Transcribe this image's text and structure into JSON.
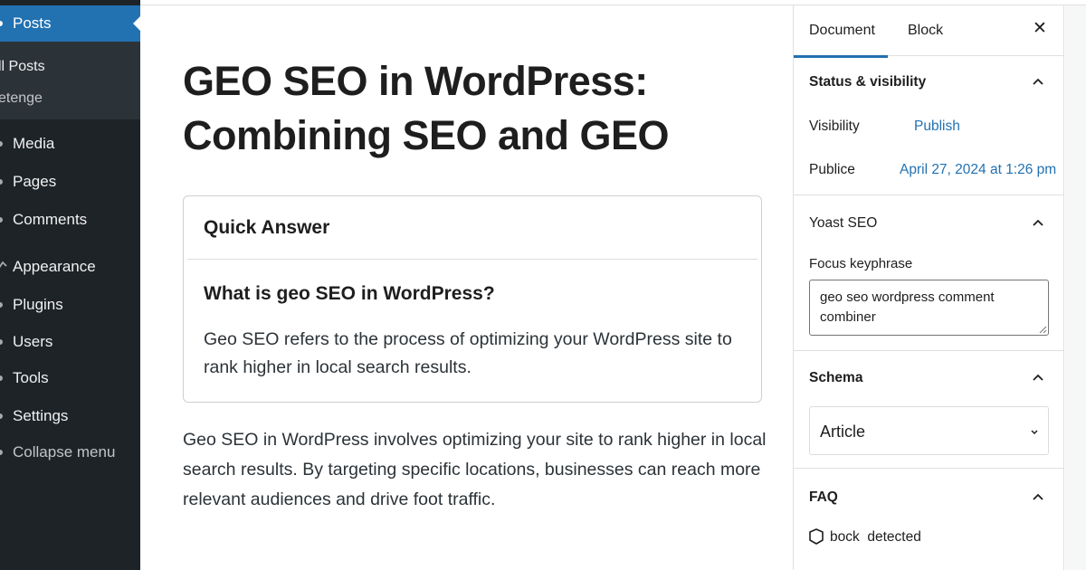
{
  "admin_menu": {
    "active_item": "Posts",
    "submenu": [
      "ll Posts",
      "etenge"
    ],
    "items": [
      "Media",
      "Pages",
      "Comments",
      "Appearance",
      "Plugins",
      "Users",
      "Tools",
      "Settings"
    ],
    "collapse_label": "Collapse menu",
    "active_color": "#2271b1",
    "background_color": "#1d2327"
  },
  "editor": {
    "title": "GEO SEO in WordPress: Combining SEO and GEO",
    "quick_answer": {
      "heading": "Quick Answer",
      "question": "What is geo SEO in WordPress?",
      "answer": "Geo SEO refers to the process of optimizing your WordPress site to rank higher in local search results."
    },
    "paragraph": "Geo SEO in WordPress involves optimizing your site to rank higher in local search results. By targeting specific locations, businesses can reach more relevant audiences and drive foot traffic."
  },
  "settings_sidebar": {
    "tabs": [
      "Document",
      "Block"
    ],
    "active_tab": "Document",
    "close_icon": "close-icon",
    "status_visibility": {
      "title": "Status & visibility",
      "visibility_label": "Visibility",
      "visibility_value": "Publish",
      "publish_label": "Publice",
      "publish_value": "April 27, 2024 at 1:26 pm"
    },
    "yoast": {
      "title": "Yoast SEO",
      "focus_label": "Focus keyphrase",
      "focus_value": "geo seo wordpress comment combiner"
    },
    "schema": {
      "title": "Schema",
      "selected": "Article"
    },
    "faq": {
      "title": "FAQ",
      "status": "bock  detected",
      "icon": "shield-icon"
    },
    "link_color": "#2271b1"
  }
}
